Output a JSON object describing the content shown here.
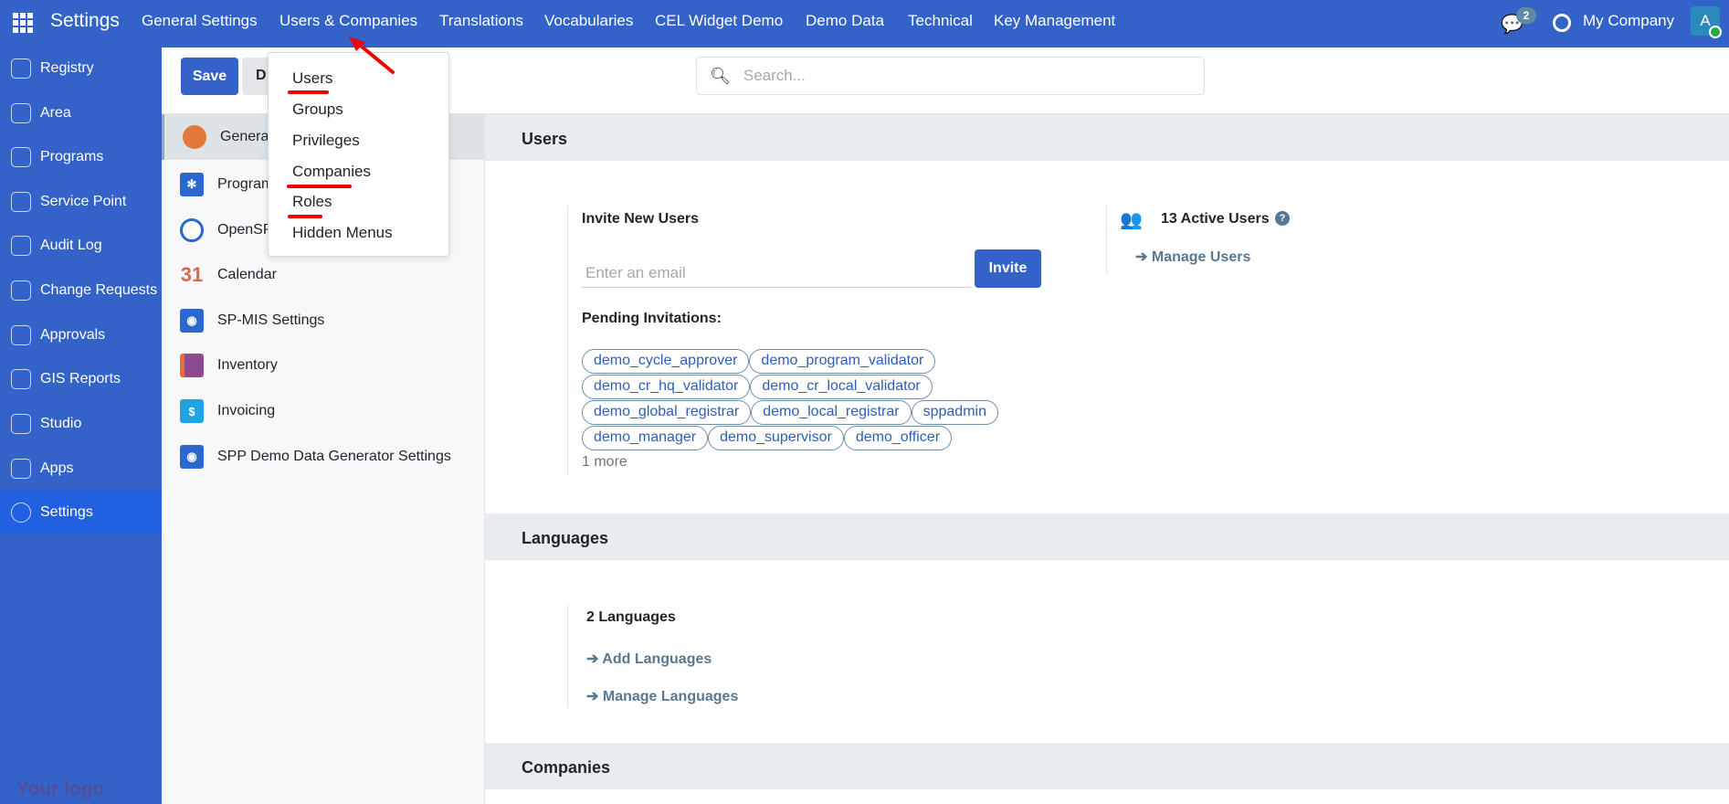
{
  "topbar": {
    "brand": "Settings",
    "menus": [
      "General Settings",
      "Users & Companies",
      "Translations",
      "Vocabularies",
      "CEL Widget Demo",
      "Demo Data",
      "Technical",
      "Key Management"
    ],
    "chat_badge": "2",
    "company": "My Company",
    "avatar": "A",
    "color": "#3363c8"
  },
  "sidebar": {
    "items": [
      "Registry",
      "Area",
      "Programs",
      "Service Point",
      "Audit Log",
      "Change Requests",
      "Approvals",
      "GIS Reports",
      "Studio",
      "Apps",
      "Settings"
    ],
    "active": "Settings",
    "logo": "Your logo"
  },
  "control": {
    "save": "Save",
    "discard": "D",
    "search_placeholder": "Search..."
  },
  "apps": [
    "General Settings",
    "Programs",
    "OpenSPP",
    "Calendar",
    "SP-MIS Settings",
    "Inventory",
    "Invoicing",
    "SPP Demo Data Generator Settings"
  ],
  "apps_visible": [
    "General",
    "Program",
    "OpenSP",
    "Calendar",
    "SP-MIS Settings",
    "Inventory",
    "Invoicing",
    "SPP Demo Data Generator Settings"
  ],
  "dropdown": {
    "items": [
      "Users",
      "Groups",
      "Privileges",
      "Companies",
      "Roles",
      "Hidden Menus"
    ],
    "underlined": [
      "Users",
      "Companies",
      "Roles"
    ]
  },
  "users": {
    "title": "Users",
    "invite_title": "Invite New Users",
    "email_placeholder": "Enter an email",
    "invite_button": "Invite",
    "pending_label": "Pending Invitations:",
    "pending": [
      "demo_cycle_approver",
      "demo_program_validator",
      "demo_cr_hq_validator",
      "demo_cr_local_validator",
      "demo_global_registrar",
      "demo_local_registrar",
      "sppadmin",
      "demo_manager",
      "demo_supervisor",
      "demo_officer"
    ],
    "more": "1 more",
    "active_users": "13 Active Users",
    "manage_users": "Manage Users"
  },
  "languages": {
    "title": "Languages",
    "count": "2 Languages",
    "add": "Add Languages",
    "manage": "Manage Languages"
  },
  "companies": {
    "title": "Companies"
  }
}
